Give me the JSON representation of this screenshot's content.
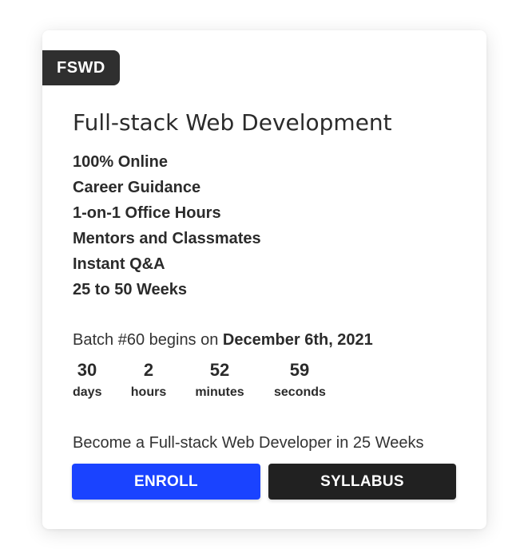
{
  "card": {
    "badge": "FSWD",
    "title": "Full-stack Web Development",
    "features": [
      "100% Online",
      "Career Guidance",
      "1-on-1 Office Hours",
      "Mentors and Classmates",
      "Instant Q&A",
      "25 to 50 Weeks"
    ],
    "batch": {
      "prefix": "Batch #60 begins on ",
      "date": "December 6th, 2021"
    },
    "countdown": {
      "days": {
        "value": "30",
        "label": "days"
      },
      "hours": {
        "value": "2",
        "label": "hours"
      },
      "minutes": {
        "value": "52",
        "label": "minutes"
      },
      "seconds": {
        "value": "59",
        "label": "seconds"
      }
    },
    "promo": "Become a Full-stack Web Developer in 25 Weeks",
    "buttons": {
      "enroll": "ENROLL",
      "syllabus": "SYLLABUS"
    }
  },
  "colors": {
    "badge_bg": "#2f2f2f",
    "enroll_bg": "#1a43ff",
    "syllabus_bg": "#212121",
    "text": "#2b2b2b"
  }
}
